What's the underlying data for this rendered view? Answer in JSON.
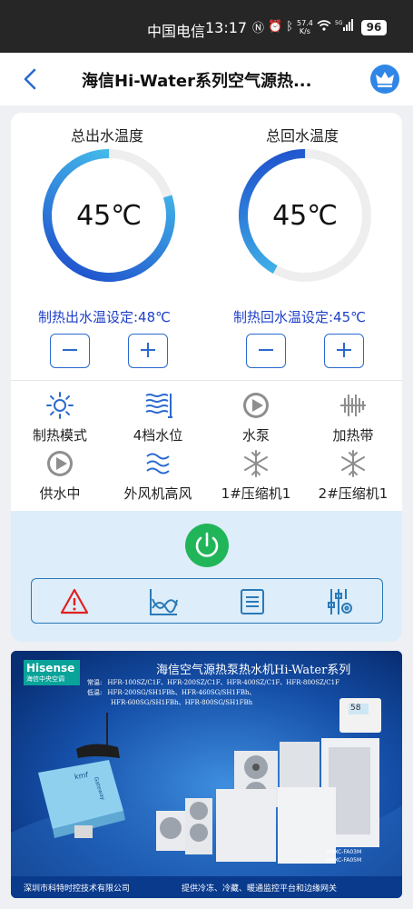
{
  "status_bar": {
    "carrier": "中国电信",
    "time": "13:17",
    "net_speed": "57.4\nK/s",
    "battery": "96"
  },
  "header": {
    "title": "海信Hi-Water系列空气源热..."
  },
  "gauges": [
    {
      "label": "总出水温度",
      "value": "45℃",
      "level": 0.8,
      "setpoint": "制热出水温设定:48℃"
    },
    {
      "label": "总回水温度",
      "value": "45℃",
      "level": 0.42,
      "setpoint": "制热回水温设定:45℃"
    }
  ],
  "stepper": {
    "minus": "−",
    "plus": "+"
  },
  "status_items": [
    {
      "label": "制热模式",
      "icon": "sun-icon"
    },
    {
      "label": "4档水位",
      "icon": "water-level-icon"
    },
    {
      "label": "水泵",
      "icon": "pump-icon"
    },
    {
      "label": "加热带",
      "icon": "heater-icon"
    },
    {
      "label": "供水中",
      "icon": "supply-icon"
    },
    {
      "label": "外风机高风",
      "icon": "fan-wind-icon"
    },
    {
      "label": "1#压缩机1",
      "icon": "snowflake-icon"
    },
    {
      "label": "2#压缩机1",
      "icon": "snowflake-icon"
    }
  ],
  "toolbar": [
    "alarm-icon",
    "chart-icon",
    "list-icon",
    "settings-sliders-icon"
  ],
  "banner": {
    "brand": "Hisense",
    "brand_sub": "海信中央空调",
    "title": "海信空气源热泵热水机Hi-Water系列",
    "line1_prefix": "常温:",
    "line1": "HFR-100SZ/C1F、HFR-200SZ/C1F、HFR-400SZ/C1F、HFR-800SZ/C1F",
    "line2_prefix": "低温:",
    "line2": "HFR-200SG/SH1FBh、HFR-460SG/SH1FBh、",
    "line3": "HFR-600SG/SH1FBh、HFR-800SG/SH1FBh",
    "controller_display": "58",
    "gateway_brand": "kmf",
    "gateway_label": "Gateway",
    "model_a": "HSXC-FA03M",
    "model_b": "HSXC-FA05M",
    "footer_left": "深圳市科特时控技术有限公司",
    "footer_right": "提供冷冻、冷藏、暖通监控平台和边缘网关"
  },
  "colors": {
    "accent": "#2a6ad0",
    "setpoint_text": "#1e3fc8",
    "power": "#21b55a",
    "alarm": "#e02020"
  }
}
